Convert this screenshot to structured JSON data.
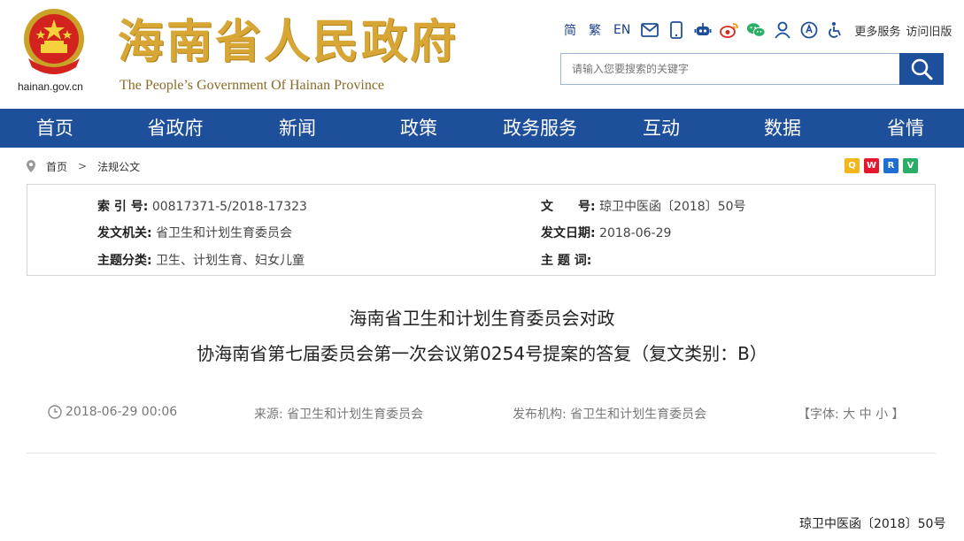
{
  "header": {
    "domain": "hainan.gov.cn",
    "title": "海南省人民政府",
    "subtitle": "The People’s Government Of Hainan Province",
    "langs": [
      "简",
      "繁",
      "EN"
    ],
    "more_services": "更多服务",
    "old_version": "访问旧版",
    "icons": [
      "mail-icon",
      "mobile-icon",
      "robot-icon",
      "weibo-icon",
      "wechat-icon",
      "user-icon",
      "voice-icon",
      "accessibility-icon"
    ]
  },
  "search": {
    "placeholder": "请输入您要搜索的关键字"
  },
  "nav": {
    "items": [
      "首页",
      "省政府",
      "新闻",
      "政策",
      "政务服务",
      "互动",
      "数据",
      "省情"
    ]
  },
  "breadcrumb": {
    "home": "首页",
    "current": "法规公文"
  },
  "meta": {
    "index_label": "索 引 号:",
    "index_value": "00817371-5/2018-17323",
    "docno_label": "文　　号:",
    "docno_value": "琼卫中医函〔2018〕50号",
    "issuer_label": "发文机关:",
    "issuer_value": "省卫生和计划生育委员会",
    "date_label": "发文日期:",
    "date_value": "2018-06-29",
    "topic_label": "主题分类:",
    "topic_value": "卫生、计划生育、妇女儿童",
    "keywords_label": "主 题 词:",
    "keywords_value": ""
  },
  "article": {
    "title_line1": "海南省卫生和计划生育委员会对政",
    "title_line2": "协海南省第七届委员会第一次会议第0254号提案的答复（复文类别：B）",
    "time": "2018-06-29 00:06",
    "source_label": "来源:",
    "source_value": "省卫生和计划生育委员会",
    "publisher_label": "发布机构:",
    "publisher_value": "省卫生和计划生育委员会",
    "font_label": "【字体:",
    "font_big": "大",
    "font_mid": "中",
    "font_small": "小",
    "font_end": "】",
    "doc_number": "琼卫中医函〔2018〕50号"
  },
  "colors": {
    "brand_blue": "#1e4f9a",
    "title_gold": "#d7a634"
  }
}
